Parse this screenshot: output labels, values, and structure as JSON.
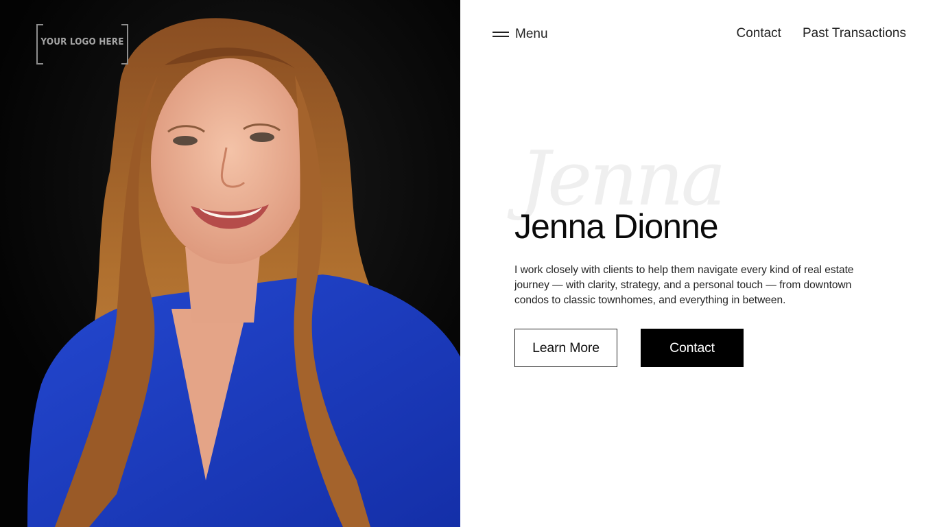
{
  "logo": {
    "text": "YOUR LOGO HERE"
  },
  "header": {
    "menu_label": "Menu",
    "nav": [
      {
        "label": "Contact"
      },
      {
        "label": "Past Transactions"
      }
    ]
  },
  "hero": {
    "script_name": "Jenna",
    "title": "Jenna Dionne",
    "description": "I work closely with clients to help them navigate every kind of real estate journey — with clarity, strategy, and a personal touch — from downtown condos to classic townhomes, and everything in between.",
    "buttons": {
      "learn_more": "Learn More",
      "contact": "Contact"
    }
  },
  "colors": {
    "accent": "#000000",
    "background": "#ffffff",
    "photo_background": "#050505",
    "shirt": "#1a3fc2",
    "hair": "#a5622a"
  },
  "icons": {
    "menu": "hamburger-icon"
  }
}
